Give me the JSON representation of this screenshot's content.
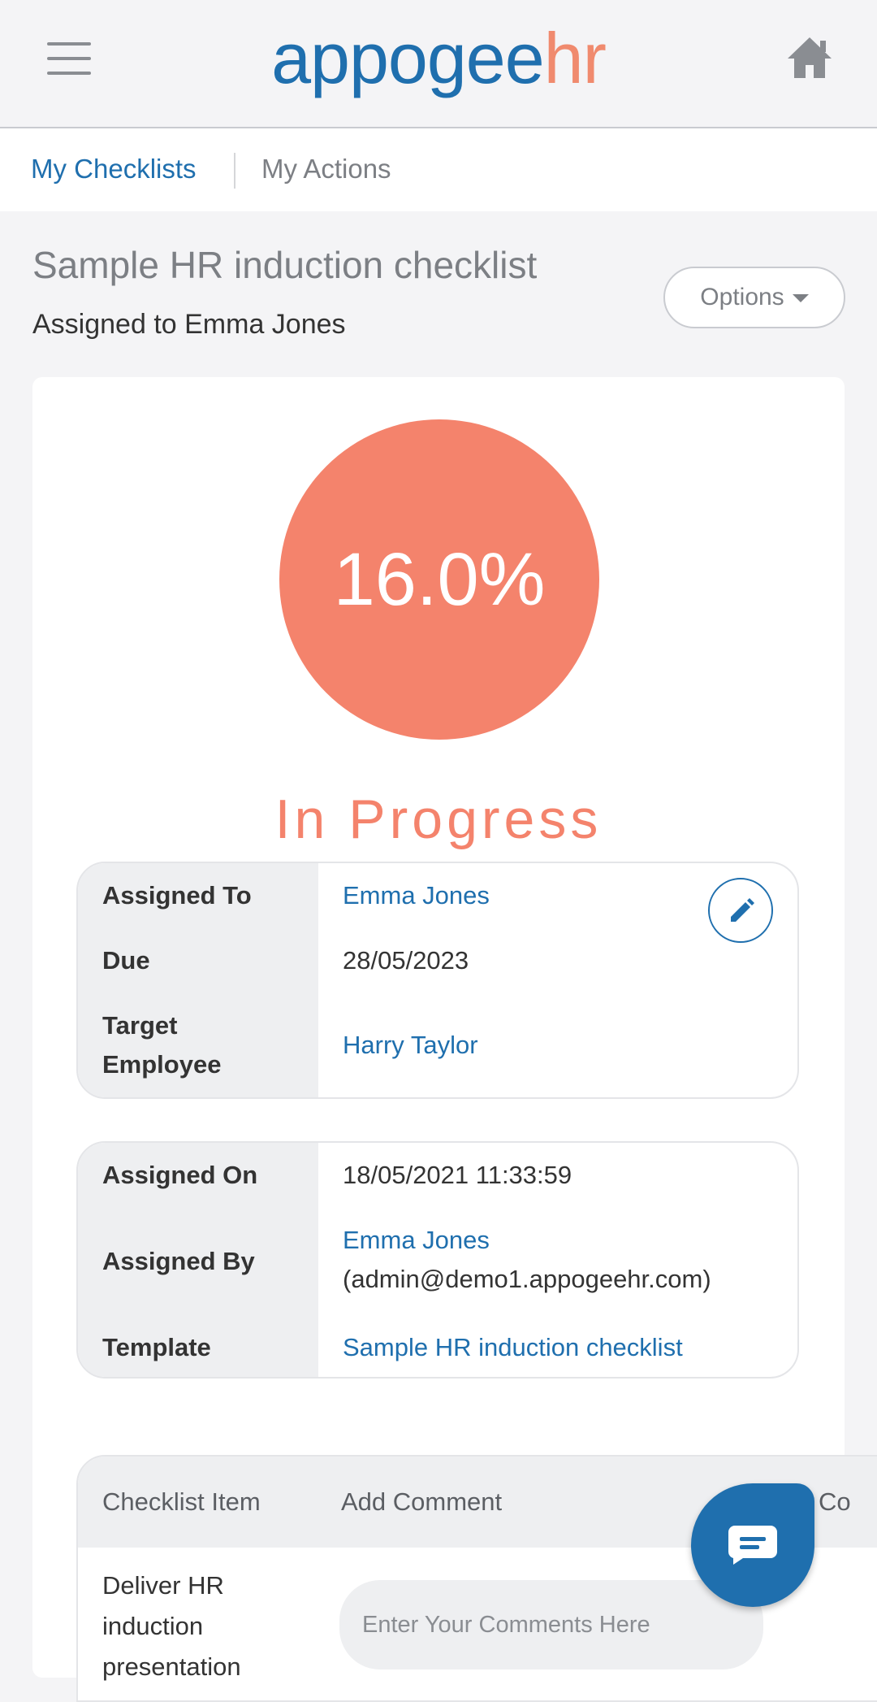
{
  "header": {
    "logo_part1": "appogee",
    "logo_part2": "hr"
  },
  "tabs": [
    {
      "label": "My Checklists",
      "active": true
    },
    {
      "label": "My Actions",
      "active": false
    }
  ],
  "checklist": {
    "title": "Sample HR induction checklist",
    "assigned_line": "Assigned to Emma Jones",
    "options_label": "Options",
    "progress": "16.0%",
    "status": "In Progress"
  },
  "details": {
    "assigned_to_label": "Assigned To",
    "assigned_to_value": "Emma Jones",
    "due_label": "Due",
    "due_value": "28/05/2023",
    "target_label": "Target Employee",
    "target_value": "Harry Taylor"
  },
  "meta": {
    "assigned_on_label": "Assigned On",
    "assigned_on_value": "18/05/2021 11:33:59",
    "assigned_by_label": "Assigned By",
    "assigned_by_name": "Emma Jones",
    "assigned_by_email": "(admin@demo1.appogeehr.com)",
    "template_label": "Template",
    "template_value": "Sample HR induction checklist"
  },
  "table": {
    "headers": [
      "Checklist Item",
      "Add Comment",
      "Co"
    ],
    "rows": [
      {
        "item": "Deliver HR induction presentation",
        "comment_placeholder": "Enter Your Comments Here"
      }
    ]
  },
  "colors": {
    "brand_blue": "#1f6fae",
    "brand_orange": "#f08a6e",
    "progress": "#f4836c"
  }
}
